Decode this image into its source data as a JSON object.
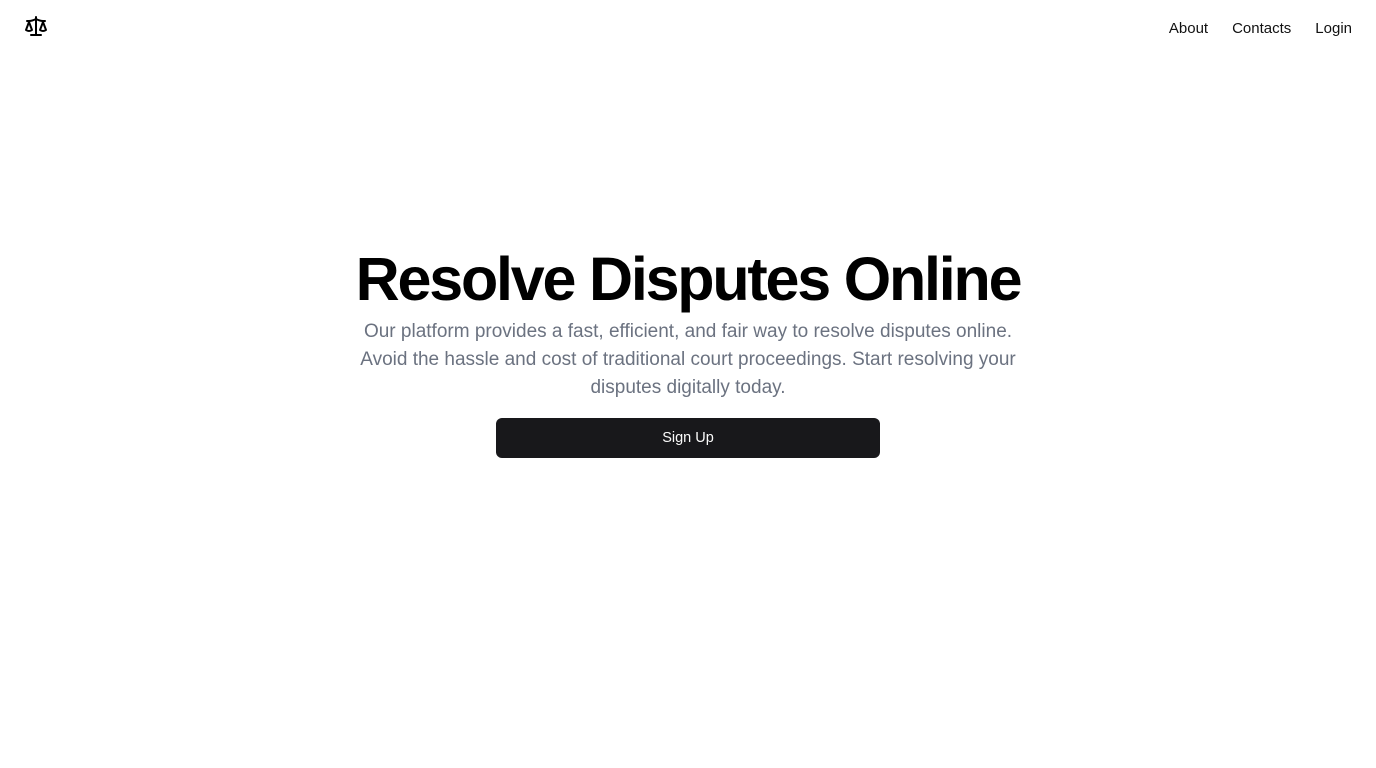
{
  "header": {
    "logo_icon": "scale-icon",
    "nav": [
      {
        "label": "About"
      },
      {
        "label": "Contacts"
      },
      {
        "label": "Login"
      }
    ]
  },
  "hero": {
    "title": "Resolve Disputes Online",
    "description": "Our platform provides a fast, efficient, and fair way to resolve disputes online. Avoid the hassle and cost of traditional court proceedings. Start resolving your disputes digitally today.",
    "cta_label": "Sign Up"
  },
  "colors": {
    "primary_button": "#18181b",
    "muted_text": "#6b7280",
    "background": "#ffffff"
  }
}
